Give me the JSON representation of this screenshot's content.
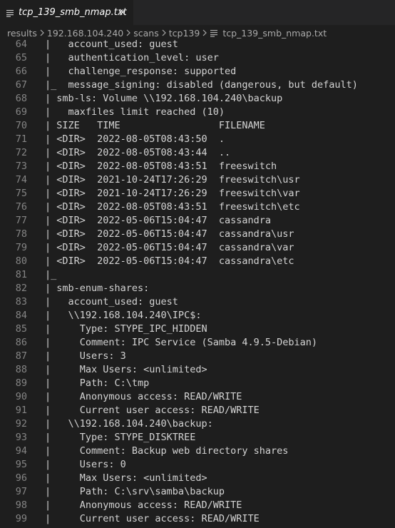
{
  "tab": {
    "title": "tcp_139_smb_nmap.txt",
    "file_icon": "text-lines-icon",
    "close_icon": "close-icon"
  },
  "breadcrumb": {
    "items": [
      "results",
      "192.168.104.240",
      "scans",
      "tcp139",
      "tcp_139_smb_nmap.txt"
    ],
    "separator_icon": "chevron-right-icon"
  },
  "editor": {
    "lines": [
      {
        "n": "64",
        "text": "|   account_used: guest"
      },
      {
        "n": "65",
        "text": "|   authentication_level: user"
      },
      {
        "n": "66",
        "text": "|   challenge_response: supported"
      },
      {
        "n": "67",
        "text": "|_  message_signing: disabled (dangerous, but default)"
      },
      {
        "n": "68",
        "text": "| smb-ls: Volume \\\\192.168.104.240\\backup"
      },
      {
        "n": "69",
        "text": "|   maxfiles limit reached (10)"
      },
      {
        "n": "70",
        "text": "| SIZE   TIME                 FILENAME"
      },
      {
        "n": "71",
        "text": "| <DIR>  2022-08-05T08:43:50  ."
      },
      {
        "n": "72",
        "text": "| <DIR>  2022-08-05T08:43:44  .."
      },
      {
        "n": "73",
        "text": "| <DIR>  2022-08-05T08:43:51  freeswitch"
      },
      {
        "n": "74",
        "text": "| <DIR>  2021-10-24T17:26:29  freeswitch\\usr"
      },
      {
        "n": "75",
        "text": "| <DIR>  2021-10-24T17:26:29  freeswitch\\var"
      },
      {
        "n": "76",
        "text": "| <DIR>  2022-08-05T08:43:51  freeswitch\\etc"
      },
      {
        "n": "77",
        "text": "| <DIR>  2022-05-06T15:04:47  cassandra"
      },
      {
        "n": "78",
        "text": "| <DIR>  2022-05-06T15:04:47  cassandra\\usr"
      },
      {
        "n": "79",
        "text": "| <DIR>  2022-05-06T15:04:47  cassandra\\var"
      },
      {
        "n": "80",
        "text": "| <DIR>  2022-05-06T15:04:47  cassandra\\etc"
      },
      {
        "n": "81",
        "text": "|_"
      },
      {
        "n": "82",
        "text": "| smb-enum-shares:"
      },
      {
        "n": "83",
        "text": "|   account_used: guest"
      },
      {
        "n": "84",
        "text": "|   \\\\192.168.104.240\\IPC$:"
      },
      {
        "n": "85",
        "text": "|     Type: STYPE_IPC_HIDDEN"
      },
      {
        "n": "86",
        "text": "|     Comment: IPC Service (Samba 4.9.5-Debian)"
      },
      {
        "n": "87",
        "text": "|     Users: 3"
      },
      {
        "n": "88",
        "text": "|     Max Users: <unlimited>"
      },
      {
        "n": "89",
        "text": "|     Path: C:\\tmp"
      },
      {
        "n": "90",
        "text": "|     Anonymous access: READ/WRITE"
      },
      {
        "n": "91",
        "text": "|     Current user access: READ/WRITE"
      },
      {
        "n": "92",
        "text": "|   \\\\192.168.104.240\\backup:"
      },
      {
        "n": "93",
        "text": "|     Type: STYPE_DISKTREE"
      },
      {
        "n": "94",
        "text": "|     Comment: Backup web directory shares"
      },
      {
        "n": "95",
        "text": "|     Users: 0"
      },
      {
        "n": "96",
        "text": "|     Max Users: <unlimited>"
      },
      {
        "n": "97",
        "text": "|     Path: C:\\srv\\samba\\backup"
      },
      {
        "n": "98",
        "text": "|     Anonymous access: READ/WRITE"
      },
      {
        "n": "99",
        "text": "|     Current user access: READ/WRITE"
      }
    ]
  },
  "colors": {
    "background": "#1e1e1e",
    "tabbar": "#252526",
    "text": "#d4d4d4",
    "line_number": "#858585",
    "breadcrumb": "#a9a9a9"
  }
}
